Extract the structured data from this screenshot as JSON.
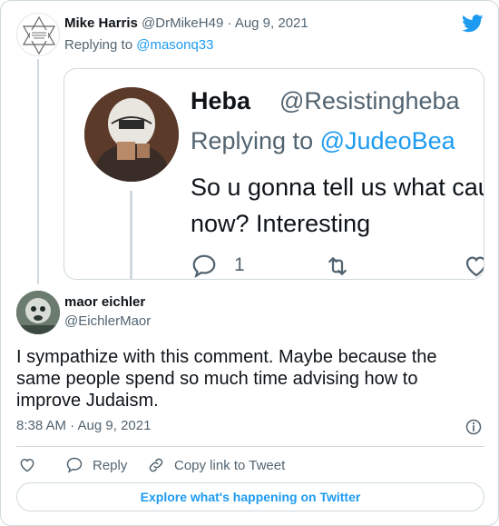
{
  "parent_tweet": {
    "name": "Mike Harris",
    "handle": "@DrMikeH49",
    "separator": "·",
    "date": "Aug 9, 2021",
    "replying_prefix": "Replying to",
    "replying_to": "@masonq33",
    "embedded_image": {
      "name": "Heba",
      "handle": "@Resistingheba",
      "replying_prefix": "Replying to",
      "replying_to": "@JudeoBea",
      "text": "So u gonna tell us what cause now? Interesting",
      "reply_count": "1"
    }
  },
  "main_tweet": {
    "name": "maor eichler",
    "handle": "@EichlerMaor",
    "text": "I sympathize with this comment. Maybe because the same people spend so much time advising how to improve Judaism.",
    "timestamp": "8:38 AM · Aug 9, 2021"
  },
  "actions": {
    "reply": "Reply",
    "copy_link": "Copy link to Tweet"
  },
  "explore_label": "Explore what's happening on Twitter",
  "colors": {
    "accent": "#1d9bf0",
    "secondary_text": "#536471",
    "border": "#cfd9de"
  },
  "icons": [
    "twitter-bird-icon",
    "heart-icon",
    "reply-icon",
    "link-icon",
    "info-icon",
    "retweet-icon"
  ]
}
